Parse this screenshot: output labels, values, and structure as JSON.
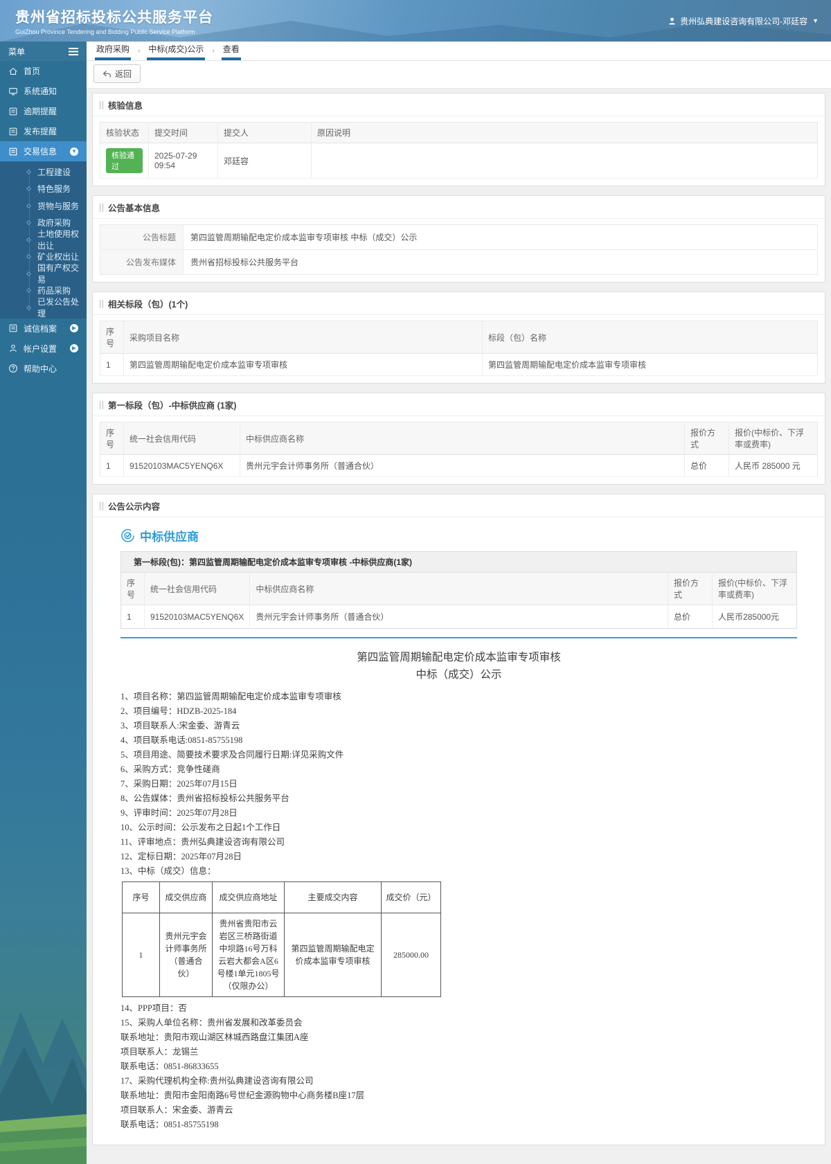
{
  "header": {
    "title": "贵州省招标投标公共服务平台",
    "subtitle": "GuiZhou Province Tendering and Bidding Public Service Platform",
    "user": "贵州弘典建设咨询有限公司-邓廷容"
  },
  "sidebar": {
    "menu_label": "菜单",
    "items": [
      {
        "label": "首页"
      },
      {
        "label": "系统通知"
      },
      {
        "label": "逾期提醒"
      },
      {
        "label": "发布提醒"
      },
      {
        "label": "交易信息"
      }
    ],
    "submenu": [
      "工程建设",
      "特色服务",
      "货物与服务",
      "政府采购",
      "土地使用权出让",
      "矿业权出让",
      "国有产权交易",
      "药品采购",
      "已发公告处理"
    ],
    "items2": [
      {
        "label": "诚信档案"
      },
      {
        "label": "帐户设置"
      },
      {
        "label": "帮助中心"
      }
    ]
  },
  "breadcrumb": [
    "政府采购",
    "中标(成交)公示",
    "查看"
  ],
  "toolbar": {
    "back_label": "返回"
  },
  "verify": {
    "title": "核验信息",
    "headers": [
      "核验状态",
      "提交时间",
      "提交人",
      "原因说明"
    ],
    "row": {
      "status": "核验通过",
      "time": "2025-07-29 09:54",
      "person": "邓廷容",
      "reason": ""
    }
  },
  "basic": {
    "title": "公告基本信息",
    "rows": [
      {
        "label": "公告标题",
        "value": "第四监管周期输配电定价成本监审专项审核 中标（成交）公示"
      },
      {
        "label": "公告发布媒体",
        "value": "贵州省招标投标公共服务平台"
      }
    ]
  },
  "related": {
    "title": "相关标段（包）(1个)",
    "headers": [
      "序号",
      "采购项目名称",
      "标段（包）名称"
    ],
    "rows": [
      [
        "1",
        "第四监管周期输配电定价成本监审专项审核",
        "第四监管周期输配电定价成本监审专项审核"
      ]
    ]
  },
  "winner": {
    "title": "第一标段（包）-中标供应商 (1家)",
    "headers": [
      "序号",
      "统一社会信用代码",
      "中标供应商名称",
      "报价方式",
      "报价(中标价、下浮率或费率)"
    ],
    "rows": [
      [
        "1",
        "91520103MAC5YENQ6X",
        "贵州元宇会计师事务所（普通合伙）",
        "总价",
        "人民币 285000 元"
      ]
    ]
  },
  "content": {
    "title": "公告公示内容",
    "supplier_heading": "中标供应商",
    "band": "第一标段(包)：第四监管周期输配电定价成本监审专项审核 -中标供应商(1家)",
    "table": {
      "headers": [
        "序号",
        "统一社会信用代码",
        "中标供应商名称",
        "报价方式",
        "报价(中标价、下浮率或费率)"
      ],
      "rows": [
        [
          "1",
          "91520103MAC5YENQ6X",
          "贵州元宇会计师事务所（普通合伙）",
          "总价",
          "人民币285000元"
        ]
      ]
    },
    "doc_title_line1": "第四监管周期输配电定价成本监审专项审核",
    "doc_title_line2": "中标（成交）公示",
    "paras": [
      "1、项目名称：第四监管周期输配电定价成本监审专项审核",
      "2、项目编号：HDZB-2025-184",
      "3、项目联系人:宋金委、游青云",
      "4、项目联系电话:0851-85755198",
      "5、项目用途、简要技术要求及合同履行日期:详见采购文件",
      "6、采购方式：竞争性磋商",
      "7、采购日期：2025年07月15日",
      "8、公告媒体：贵州省招标投标公共服务平台",
      "9、评审时间：2025年07月28日",
      "10、公示时间：公示发布之日起1个工作日",
      "11、评审地点：贵州弘典建设咨询有限公司",
      "12、定标日期：2025年07月28日",
      "13、中标（成交）信息："
    ],
    "award_table": {
      "headers": [
        "序号",
        "成交供应商",
        "成交供应商地址",
        "主要成交内容",
        "成交价（元）"
      ],
      "rows": [
        [
          "1",
          "贵州元宇会计师事务所（普通合伙）",
          "贵州省贵阳市云岩区三桥路街道中坝路16号万科云岩大都会A区6号楼1单元1805号（仅限办公）",
          "第四监管周期输配电定价成本监审专项审核",
          "285000.00"
        ]
      ]
    },
    "paras2": [
      "14、PPP项目：否",
      "15、采购人单位名称：贵州省发展和改革委员会",
      "联系地址：贵阳市观山湖区林城西路盘江集团A座",
      "项目联系人：龙锡兰",
      "联系电话：0851-86833655",
      "17、采购代理机构全称:贵州弘典建设咨询有限公司",
      "联系地址：贵阳市金阳南路6号世纪金源购物中心商务楼B座17层",
      "项目联系人：宋金委、游青云",
      "联系电话：0851-85755198"
    ]
  },
  "colors": {
    "accent_blue": "#2e9cd6",
    "active_menu_blue": "#3e8ecb",
    "badge_green": "#53b253",
    "crumb_underline": "#1e6ca3"
  }
}
